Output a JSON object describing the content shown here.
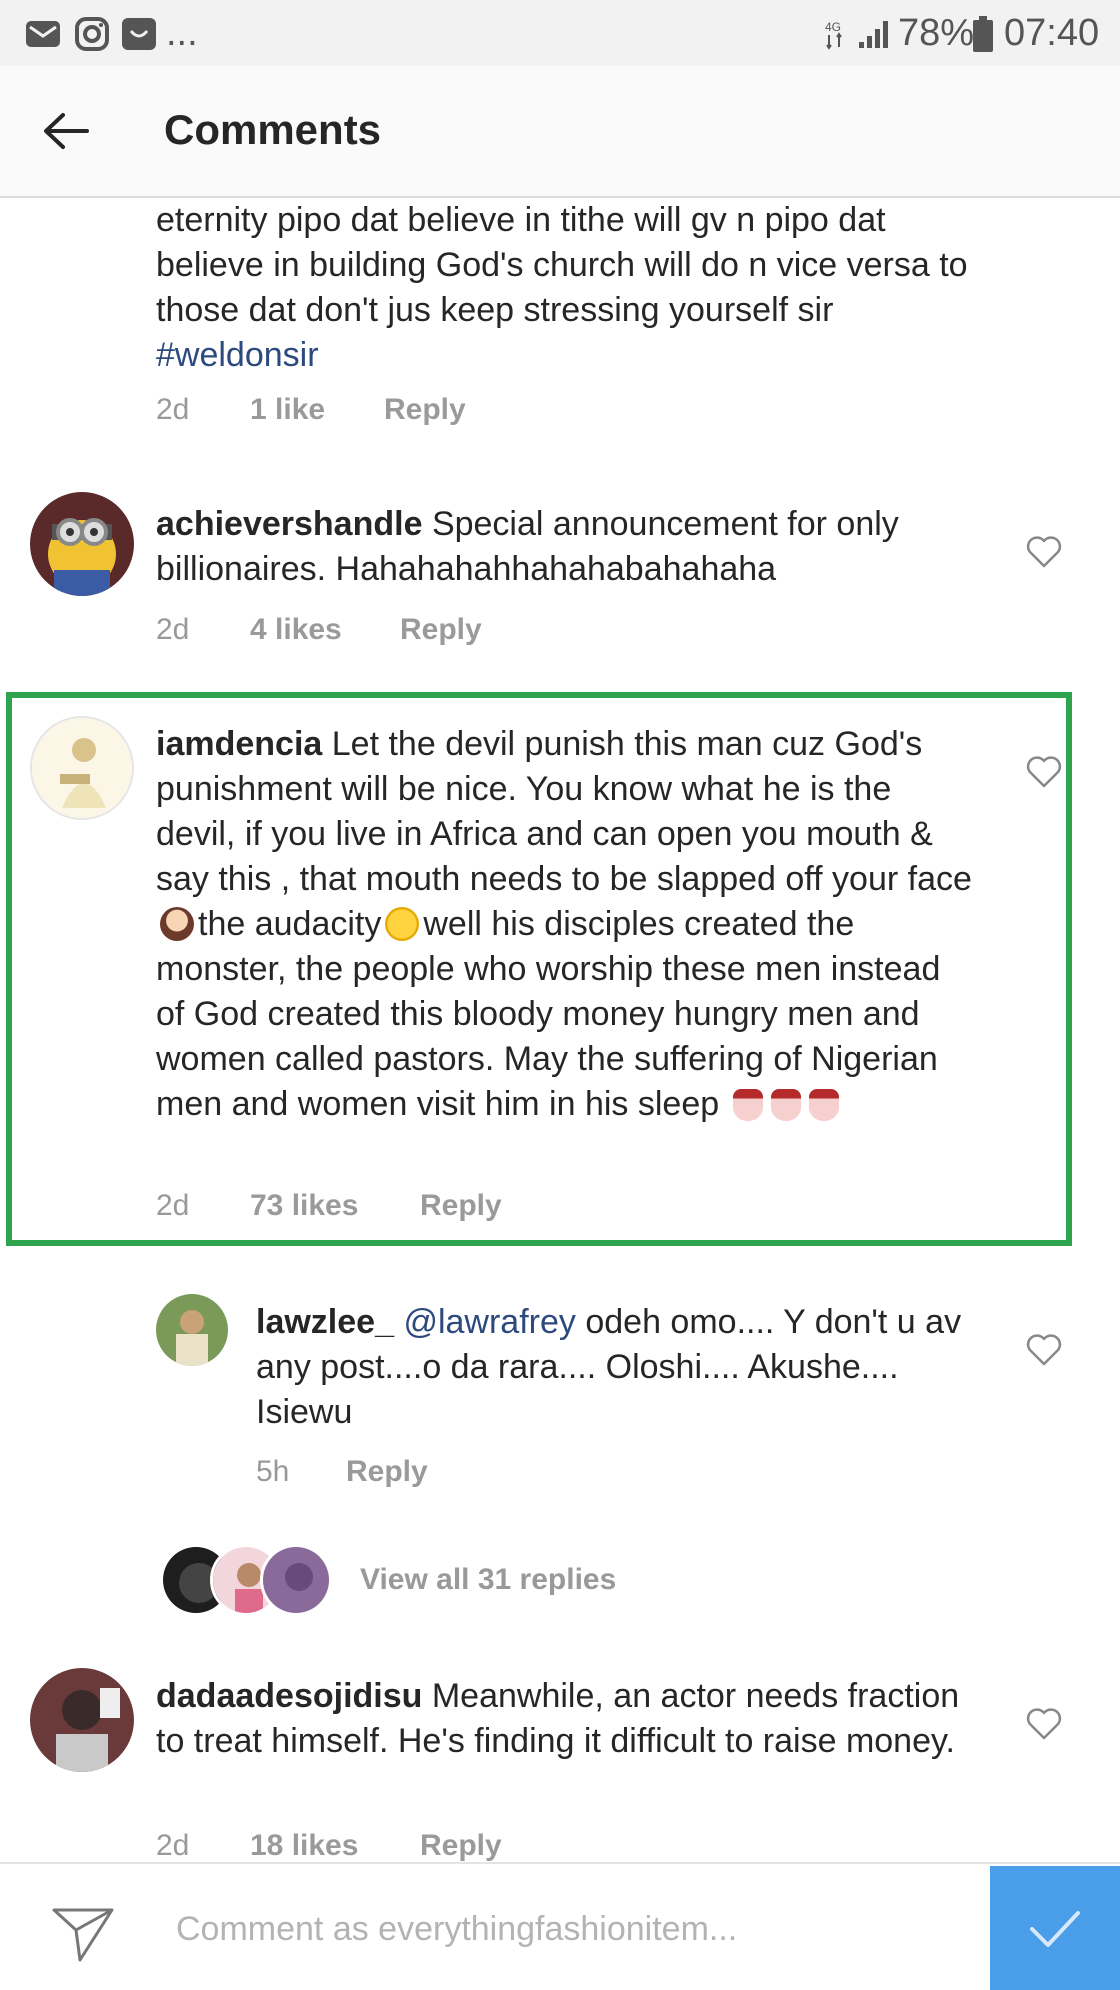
{
  "status_bar": {
    "network": "4G",
    "battery": "78%",
    "time": "07:40",
    "left_icons": [
      "mail-icon",
      "instagram-icon",
      "app-icon",
      "more-icon"
    ],
    "ellipsis": "..."
  },
  "header": {
    "title": "Comments",
    "back_icon": "back-arrow-icon"
  },
  "comments": [
    {
      "text": "eternity pipo dat believe in tithe will gv n pipo dat believe in building God's church will do n vice versa to those dat don't jus keep stressing yourself sir",
      "hashtag": "#weldonsir",
      "time": "2d",
      "likes": "1 like",
      "reply": "Reply"
    },
    {
      "username": "achievershandle",
      "text": "Special announcement for only billionaires. Hahahahahhahahabahahaha",
      "time": "2d",
      "likes": "4 likes",
      "reply": "Reply"
    },
    {
      "username": "iamdencia",
      "text_part1": "Let the devil punish this man cuz God's punishment will be nice. You know what he is the devil, if you live in Africa and can open you mouth & say this , that mouth needs to be slapped off your face",
      "text_part2": "the audacity",
      "text_part3": "well his disciples created the monster, the people who worship these men instead of God created this bloody money hungry men and women called pastors. May the suffering of Nigerian men and women visit him in his sleep",
      "time": "2d",
      "likes": "73 likes",
      "reply": "Reply",
      "highlight_color": "#2ea44f"
    },
    {
      "username": "lawzlee_",
      "mention": "@lawrafrey",
      "text": "odeh omo.... Y don't u av any post....o da rara.... Oloshi.... Akushe.... Isiewu",
      "time": "5h",
      "reply": "Reply"
    },
    {
      "username": "dadaadesojidisu",
      "text": "Meanwhile, an actor needs fraction to treat himself. He's finding it difficult to raise money.",
      "time": "2d",
      "likes": "18 likes",
      "reply": "Reply"
    }
  ],
  "view_replies": "View all 31 replies",
  "composer": {
    "placeholder": "Comment as everythingfashionitem...",
    "accent": "#4a9de8"
  }
}
